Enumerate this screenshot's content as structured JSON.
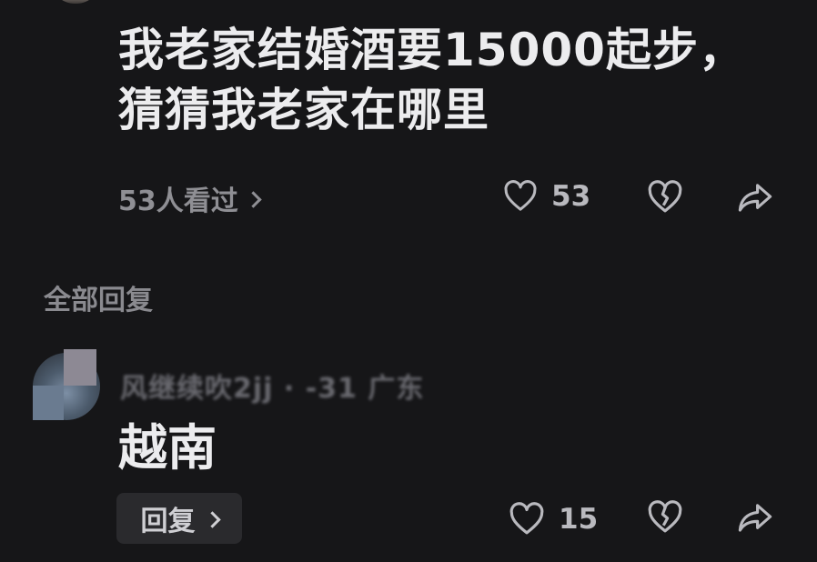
{
  "post": {
    "text": "我老家结婚酒要15000起步，猜猜我老家在哪里",
    "views_text": "53人看过",
    "like_count": "53"
  },
  "replies_section": {
    "title": "全部回复"
  },
  "reply": {
    "username": "风继续吹2jj · -31 广东",
    "text": "越南",
    "reply_label": "回复",
    "like_count": "15"
  },
  "icons": {
    "like": "heart-outline-icon",
    "dislike": "broken-heart-icon",
    "share": "share-arrow-icon",
    "chevron": "chevron-right-icon"
  },
  "colors": {
    "background": "#161618",
    "primary_text": "#ececee",
    "secondary_text": "#8f8f94",
    "button_bg": "#2a2a2d"
  }
}
